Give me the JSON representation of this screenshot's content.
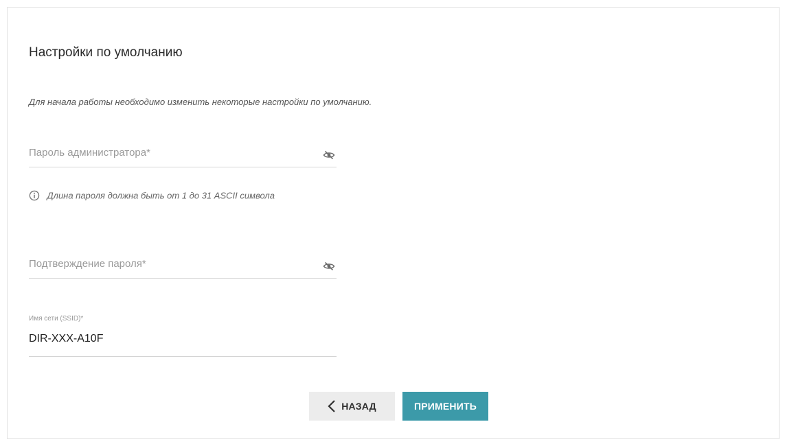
{
  "page": {
    "title": "Настройки по умолчанию",
    "intro": "Для начала работы необходимо изменить некоторые настройки по умолчанию."
  },
  "form": {
    "admin_password": {
      "placeholder": "Пароль администратора*",
      "value": "",
      "icon": "eye-off-icon"
    },
    "password_hint": {
      "icon": "info-icon",
      "text": "Длина пароля должна быть от 1 до 31 ASCII символа"
    },
    "confirm_password": {
      "placeholder": "Подтверждение пароля*",
      "value": "",
      "icon": "eye-off-icon"
    },
    "ssid": {
      "label": "Имя сети (SSID)*",
      "value": "DIR-XXX-A10F"
    }
  },
  "buttons": {
    "back": {
      "label": "НАЗАД",
      "icon": "chevron-left-icon"
    },
    "apply": {
      "label": "ПРИМЕНИТЬ"
    }
  },
  "colors": {
    "accent": "#3c9aa9",
    "back_button_bg": "#ececec",
    "border": "#e2e2e2"
  }
}
